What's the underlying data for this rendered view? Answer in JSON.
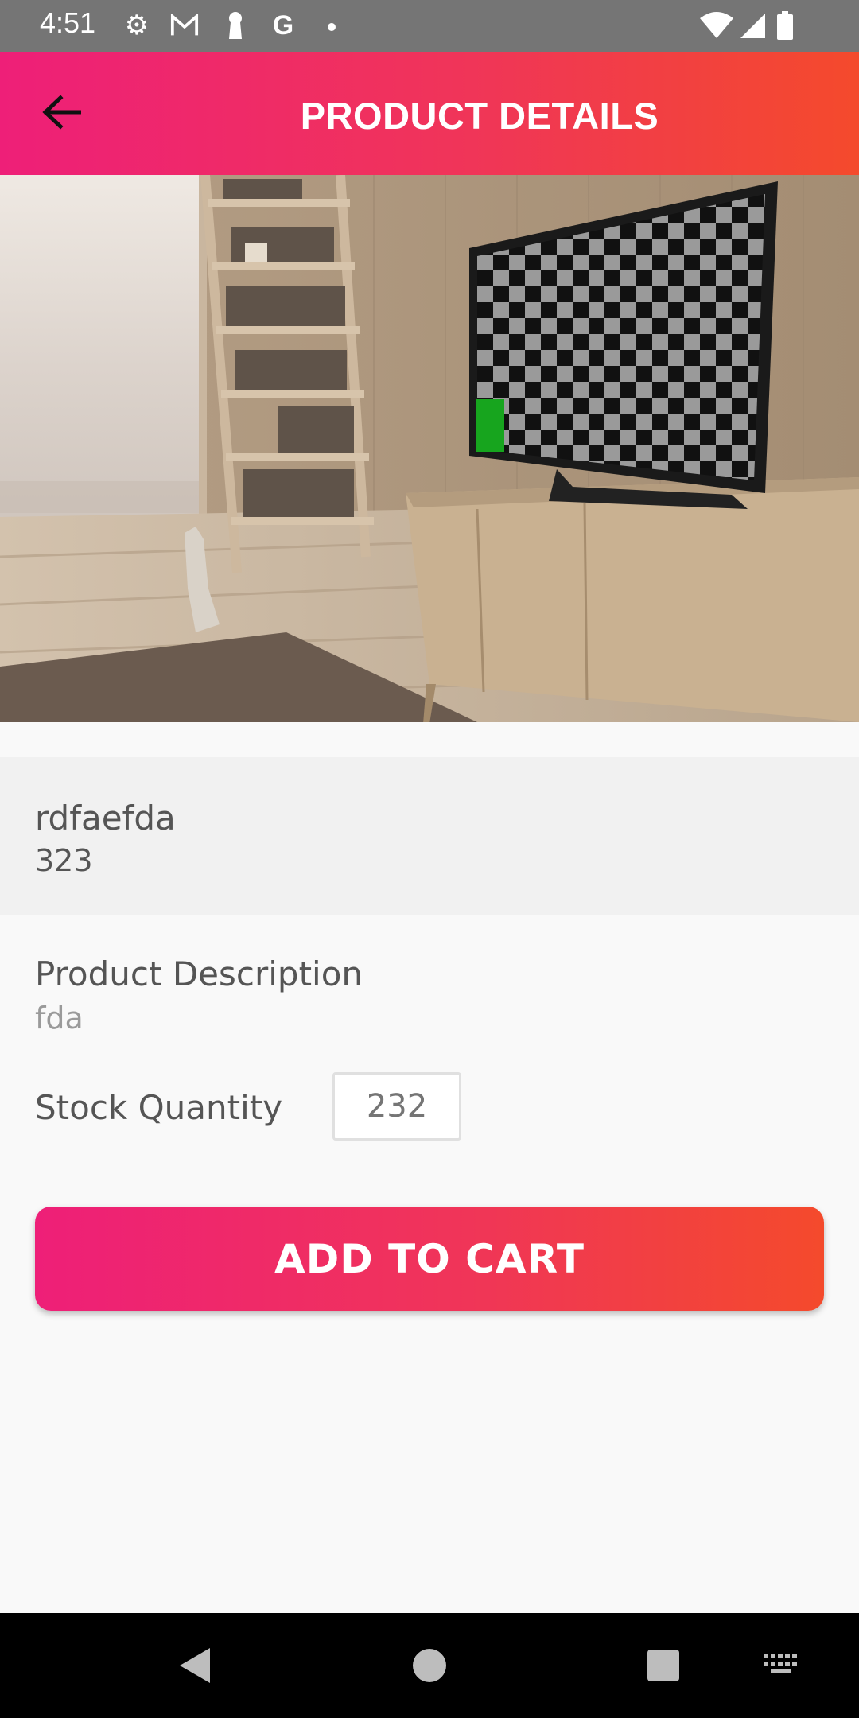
{
  "status_bar": {
    "time": "4:51",
    "icons": [
      "gear-icon",
      "gmail-icon",
      "keyhole-icon",
      "google-icon",
      "dot-icon",
      "wifi-icon",
      "signal-icon",
      "battery-icon"
    ]
  },
  "app_bar": {
    "title": "PRODUCT DETAILS",
    "back_icon": "arrow-left-icon"
  },
  "product": {
    "name": "rdfaefda",
    "price": "323",
    "description_label": "Product Description",
    "description": "fda",
    "stock_label": "Stock Quantity",
    "stock_value": "232"
  },
  "actions": {
    "add_to_cart_label": "ADD TO CART"
  },
  "nav_bar": {
    "icons": [
      "back-triangle-icon",
      "home-circle-icon",
      "recents-square-icon",
      "keyboard-icon"
    ]
  },
  "colors": {
    "gradient_start": "#ee1f78",
    "gradient_end": "#f44a2c",
    "status_bar": "#757575",
    "nav_bar": "#000000"
  }
}
